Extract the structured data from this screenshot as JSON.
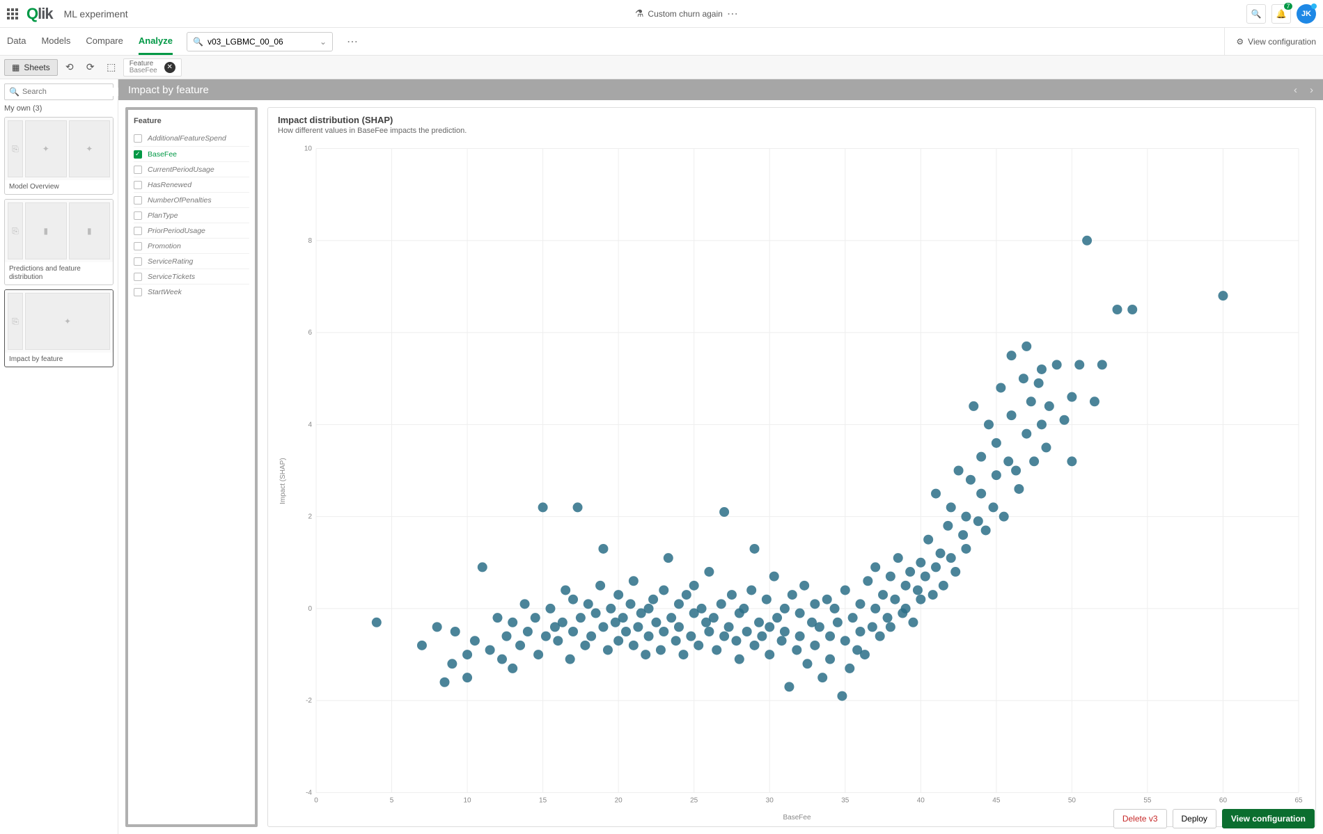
{
  "header": {
    "page_title": "ML experiment",
    "center_label": "Custom churn again",
    "badge_count": "7",
    "avatar_initials": "JK"
  },
  "tabs": [
    "Data",
    "Models",
    "Compare",
    "Analyze"
  ],
  "active_tab": 3,
  "model_selector": {
    "value": "v03_LGBMC_00_06"
  },
  "view_config": "View configuration",
  "toolbar": {
    "sheets_label": "Sheets",
    "filter": {
      "title": "Feature",
      "value": "BaseFee"
    }
  },
  "left": {
    "search_placeholder": "Search",
    "myown_label": "My own (3)",
    "sheets": [
      {
        "label": "Model Overview"
      },
      {
        "label": "Predictions and feature distribution"
      },
      {
        "label": "Impact by feature"
      }
    ],
    "selected_sheet": 2
  },
  "section_title": "Impact by feature",
  "features": {
    "title": "Feature",
    "items": [
      "AdditionalFeatureSpend",
      "BaseFee",
      "CurrentPeriodUsage",
      "HasRenewed",
      "NumberOfPenalties",
      "PlanType",
      "PriorPeriodUsage",
      "Promotion",
      "ServiceRating",
      "ServiceTickets",
      "StartWeek"
    ],
    "selected": "BaseFee"
  },
  "chart": {
    "title": "Impact distribution (SHAP)",
    "subtitle": "How different values in BaseFee impacts the prediction.",
    "xlabel": "BaseFee",
    "ylabel": "Impact (SHAP)"
  },
  "chart_data": {
    "type": "scatter",
    "xlabel": "BaseFee",
    "ylabel": "Impact (SHAP)",
    "xlim": [
      0,
      65
    ],
    "ylim": [
      -4,
      10
    ],
    "x_ticks": [
      0,
      5,
      10,
      15,
      20,
      25,
      30,
      35,
      40,
      45,
      50,
      55,
      60,
      65
    ],
    "y_ticks": [
      -4,
      -2,
      0,
      2,
      4,
      6,
      8,
      10
    ],
    "series": [
      {
        "name": "BaseFee SHAP",
        "color": "#2c6e87",
        "points": [
          [
            4,
            -0.3
          ],
          [
            7,
            -0.8
          ],
          [
            8,
            -0.4
          ],
          [
            8.5,
            -1.6
          ],
          [
            9,
            -1.2
          ],
          [
            9.2,
            -0.5
          ],
          [
            10,
            -1.0
          ],
          [
            10,
            -1.5
          ],
          [
            10.5,
            -0.7
          ],
          [
            11,
            0.9
          ],
          [
            11.5,
            -0.9
          ],
          [
            12,
            -0.2
          ],
          [
            12.3,
            -1.1
          ],
          [
            12.6,
            -0.6
          ],
          [
            13,
            -0.3
          ],
          [
            13,
            -1.3
          ],
          [
            13.5,
            -0.8
          ],
          [
            13.8,
            0.1
          ],
          [
            14,
            -0.5
          ],
          [
            14.5,
            -0.2
          ],
          [
            14.7,
            -1.0
          ],
          [
            15,
            2.2
          ],
          [
            15.2,
            -0.6
          ],
          [
            15.5,
            0.0
          ],
          [
            15.8,
            -0.4
          ],
          [
            16,
            -0.7
          ],
          [
            16.3,
            -0.3
          ],
          [
            16.5,
            0.4
          ],
          [
            16.8,
            -1.1
          ],
          [
            17,
            0.2
          ],
          [
            17,
            -0.5
          ],
          [
            17.3,
            2.2
          ],
          [
            17.5,
            -0.2
          ],
          [
            17.8,
            -0.8
          ],
          [
            18,
            0.1
          ],
          [
            18.2,
            -0.6
          ],
          [
            18.5,
            -0.1
          ],
          [
            18.8,
            0.5
          ],
          [
            19,
            -0.4
          ],
          [
            19,
            1.3
          ],
          [
            19.3,
            -0.9
          ],
          [
            19.5,
            0.0
          ],
          [
            19.8,
            -0.3
          ],
          [
            20,
            -0.7
          ],
          [
            20,
            0.3
          ],
          [
            20.3,
            -0.2
          ],
          [
            20.5,
            -0.5
          ],
          [
            20.8,
            0.1
          ],
          [
            21,
            -0.8
          ],
          [
            21,
            0.6
          ],
          [
            21.3,
            -0.4
          ],
          [
            21.5,
            -0.1
          ],
          [
            21.8,
            -1.0
          ],
          [
            22,
            0.0
          ],
          [
            22,
            -0.6
          ],
          [
            22.3,
            0.2
          ],
          [
            22.5,
            -0.3
          ],
          [
            22.8,
            -0.9
          ],
          [
            23,
            0.4
          ],
          [
            23,
            -0.5
          ],
          [
            23.3,
            1.1
          ],
          [
            23.5,
            -0.2
          ],
          [
            23.8,
            -0.7
          ],
          [
            24,
            0.1
          ],
          [
            24,
            -0.4
          ],
          [
            24.3,
            -1.0
          ],
          [
            24.5,
            0.3
          ],
          [
            24.8,
            -0.6
          ],
          [
            25,
            -0.1
          ],
          [
            25,
            0.5
          ],
          [
            25.3,
            -0.8
          ],
          [
            25.5,
            0.0
          ],
          [
            25.8,
            -0.3
          ],
          [
            26,
            -0.5
          ],
          [
            26,
            0.8
          ],
          [
            26.3,
            -0.2
          ],
          [
            26.5,
            -0.9
          ],
          [
            26.8,
            0.1
          ],
          [
            27,
            2.1
          ],
          [
            27,
            -0.6
          ],
          [
            27.3,
            -0.4
          ],
          [
            27.5,
            0.3
          ],
          [
            27.8,
            -0.7
          ],
          [
            28,
            -0.1
          ],
          [
            28,
            -1.1
          ],
          [
            28.3,
            0.0
          ],
          [
            28.5,
            -0.5
          ],
          [
            28.8,
            0.4
          ],
          [
            29,
            -0.8
          ],
          [
            29,
            1.3
          ],
          [
            29.3,
            -0.3
          ],
          [
            29.5,
            -0.6
          ],
          [
            29.8,
            0.2
          ],
          [
            30,
            -0.4
          ],
          [
            30,
            -1.0
          ],
          [
            30.3,
            0.7
          ],
          [
            30.5,
            -0.2
          ],
          [
            30.8,
            -0.7
          ],
          [
            31,
            0.0
          ],
          [
            31,
            -0.5
          ],
          [
            31.3,
            -1.7
          ],
          [
            31.5,
            0.3
          ],
          [
            31.8,
            -0.9
          ],
          [
            32,
            -0.1
          ],
          [
            32,
            -0.6
          ],
          [
            32.3,
            0.5
          ],
          [
            32.5,
            -1.2
          ],
          [
            32.8,
            -0.3
          ],
          [
            33,
            0.1
          ],
          [
            33,
            -0.8
          ],
          [
            33.3,
            -0.4
          ],
          [
            33.5,
            -1.5
          ],
          [
            33.8,
            0.2
          ],
          [
            34,
            -0.6
          ],
          [
            34,
            -1.1
          ],
          [
            34.3,
            0.0
          ],
          [
            34.5,
            -0.3
          ],
          [
            34.8,
            -1.9
          ],
          [
            35,
            -0.7
          ],
          [
            35,
            0.4
          ],
          [
            35.3,
            -1.3
          ],
          [
            35.5,
            -0.2
          ],
          [
            35.8,
            -0.9
          ],
          [
            36,
            0.1
          ],
          [
            36,
            -0.5
          ],
          [
            36.3,
            -1.0
          ],
          [
            36.5,
            0.6
          ],
          [
            36.8,
            -0.4
          ],
          [
            37,
            0.0
          ],
          [
            37,
            0.9
          ],
          [
            37.3,
            -0.6
          ],
          [
            37.5,
            0.3
          ],
          [
            37.8,
            -0.2
          ],
          [
            38,
            0.7
          ],
          [
            38,
            -0.4
          ],
          [
            38.3,
            0.2
          ],
          [
            38.5,
            1.1
          ],
          [
            38.8,
            -0.1
          ],
          [
            39,
            0.5
          ],
          [
            39,
            0.0
          ],
          [
            39.3,
            0.8
          ],
          [
            39.5,
            -0.3
          ],
          [
            39.8,
            0.4
          ],
          [
            40,
            1.0
          ],
          [
            40,
            0.2
          ],
          [
            40.3,
            0.7
          ],
          [
            40.5,
            1.5
          ],
          [
            40.8,
            0.3
          ],
          [
            41,
            0.9
          ],
          [
            41,
            2.5
          ],
          [
            41.3,
            1.2
          ],
          [
            41.5,
            0.5
          ],
          [
            41.8,
            1.8
          ],
          [
            42,
            1.1
          ],
          [
            42,
            2.2
          ],
          [
            42.3,
            0.8
          ],
          [
            42.5,
            3.0
          ],
          [
            42.8,
            1.6
          ],
          [
            43,
            2.0
          ],
          [
            43,
            1.3
          ],
          [
            43.3,
            2.8
          ],
          [
            43.5,
            4.4
          ],
          [
            43.8,
            1.9
          ],
          [
            44,
            2.5
          ],
          [
            44,
            3.3
          ],
          [
            44.3,
            1.7
          ],
          [
            44.5,
            4.0
          ],
          [
            44.8,
            2.2
          ],
          [
            45,
            3.6
          ],
          [
            45,
            2.9
          ],
          [
            45.3,
            4.8
          ],
          [
            45.5,
            2.0
          ],
          [
            45.8,
            3.2
          ],
          [
            46,
            4.2
          ],
          [
            46,
            5.5
          ],
          [
            46.3,
            3.0
          ],
          [
            46.5,
            2.6
          ],
          [
            46.8,
            5.0
          ],
          [
            47,
            3.8
          ],
          [
            47,
            5.7
          ],
          [
            47.3,
            4.5
          ],
          [
            47.5,
            3.2
          ],
          [
            47.8,
            4.9
          ],
          [
            48,
            4.0
          ],
          [
            48,
            5.2
          ],
          [
            48.3,
            3.5
          ],
          [
            48.5,
            4.4
          ],
          [
            49,
            5.3
          ],
          [
            49.5,
            4.1
          ],
          [
            50,
            4.6
          ],
          [
            50,
            3.2
          ],
          [
            50.5,
            5.3
          ],
          [
            51,
            8.0
          ],
          [
            51.5,
            4.5
          ],
          [
            52,
            5.3
          ],
          [
            53,
            6.5
          ],
          [
            54,
            6.5
          ],
          [
            60,
            6.8
          ]
        ]
      }
    ]
  },
  "footer": {
    "delete": "Delete v3",
    "deploy": "Deploy",
    "view_config": "View configuration"
  }
}
